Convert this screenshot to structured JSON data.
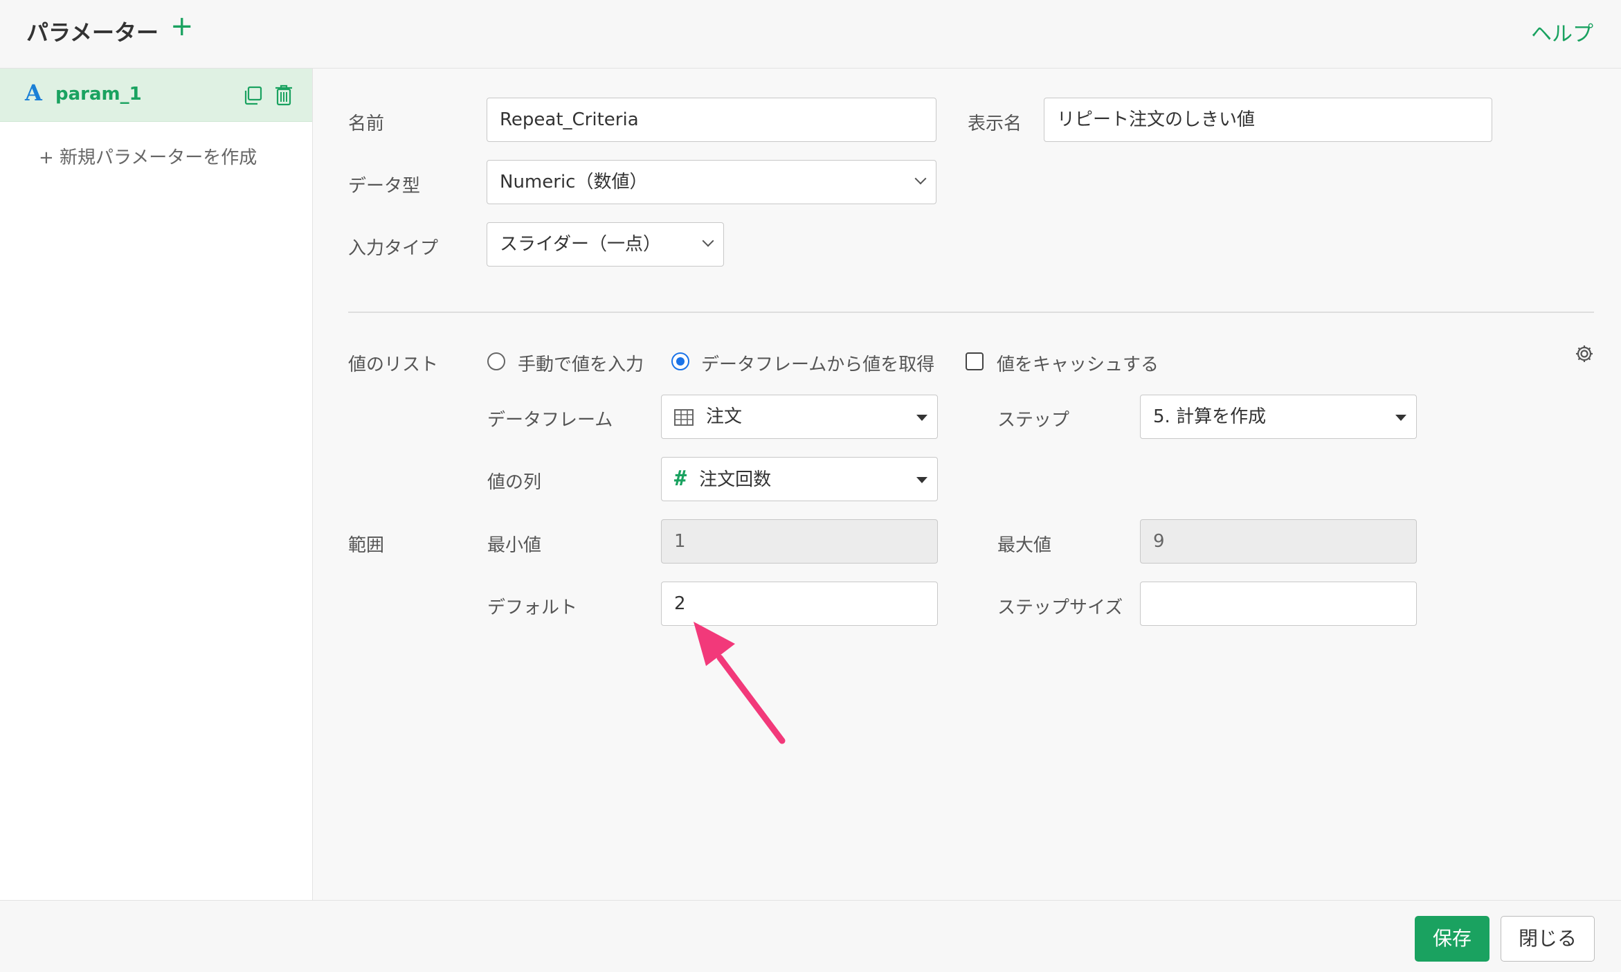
{
  "header": {
    "title": "パラメーター",
    "add_icon": "plus-icon",
    "help_label": "ヘルプ"
  },
  "sidebar": {
    "param": {
      "type_glyph": "A",
      "name": "param_1"
    },
    "new_param_label": "+ 新規パラメーターを作成"
  },
  "form": {
    "name_label": "名前",
    "name_value": "Repeat_Criteria",
    "display_name_label": "表示名",
    "display_name_value": "リピート注文のしきい値",
    "data_type_label": "データ型",
    "data_type_value": "Numeric（数値）",
    "input_type_label": "入力タイプ",
    "input_type_value": "スライダー（一点）",
    "value_list_label": "値のリスト",
    "radio_manual_label": "手動で値を入力",
    "radio_dataframe_label": "データフレームから値を取得",
    "cache_label": "値をキャッシュする",
    "dataframe_label": "データフレーム",
    "dataframe_value": "注文",
    "step_label": "ステップ",
    "step_value": "5. 計算を作成",
    "value_column_label": "値の列",
    "value_column_value": "注文回数",
    "range_label": "範囲",
    "min_label": "最小値",
    "min_value": "1",
    "max_label": "最大値",
    "max_value": "9",
    "default_label": "デフォルト",
    "default_value": "2",
    "step_size_label": "ステップサイズ",
    "step_size_value": ""
  },
  "footer": {
    "save_label": "保存",
    "close_label": "閉じる"
  },
  "colors": {
    "accent": "#1aa260",
    "selected_bg": "#dff1e3",
    "radio": "#1a73e8",
    "annotation_arrow": "#f2397a"
  }
}
